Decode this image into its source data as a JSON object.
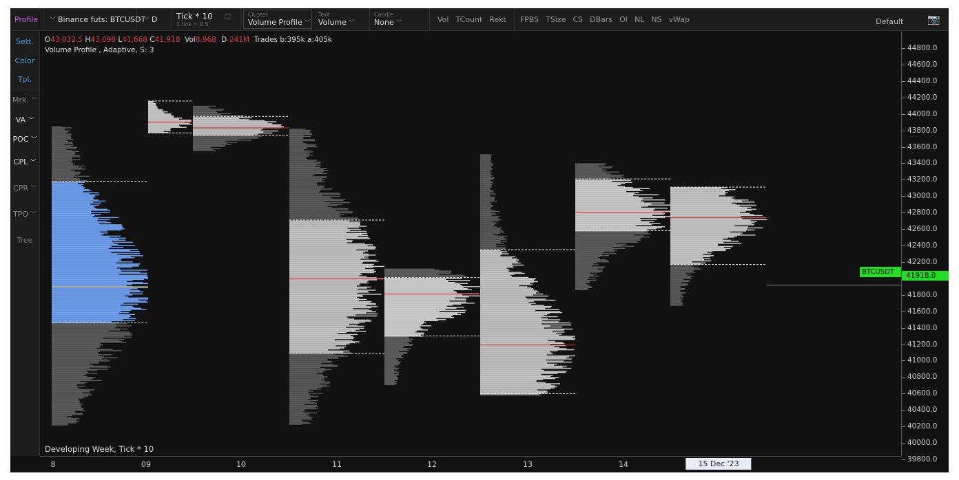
{
  "toolbar": {
    "profile": "Profile",
    "instrument": "Binance futs: BTCUSDT",
    "timeframe": "D",
    "tick": "Tick * 10",
    "tick_sub": "1 tick = 0.5",
    "cluster_cap": "Cluster",
    "cluster": "Volume Profile",
    "text_cap": "Text",
    "text": "Volume",
    "candle_cap": "Candle",
    "candle": "None",
    "toggles1": [
      "Vol",
      "TCount",
      "Rekt"
    ],
    "toggles2": [
      "FPBS",
      "TSize",
      "CS",
      "DBars",
      "OI",
      "NL",
      "NS",
      "vWap"
    ],
    "template": "Default",
    "camera_icon": "camera-icon"
  },
  "sidebar": {
    "top": [
      "Sett.",
      "Color",
      "Tpl."
    ],
    "items": [
      "Mrk.",
      "VA",
      "POC",
      "CPL",
      "CPR",
      "TPO",
      "Tree"
    ]
  },
  "info": {
    "o_label": "O",
    "o": "43,032.5",
    "h_label": "H",
    "h": "43,098",
    "l_label": "L",
    "l": "41,668",
    "c_label": "C",
    "c": "41,918",
    "vol_label": "Vol",
    "vol": "8.96B",
    "d_label": "D",
    "d": "-241M",
    "trades": "Trades b:395k a:405k",
    "subtitle": "Volume Profile , Adaptive, S: 3"
  },
  "footer": "Developing Week, Tick * 10",
  "price": {
    "symbol": "BTCUSDT",
    "last": "41918.0",
    "last_value": 41918
  },
  "axis_ticks": [
    "44800.0",
    "44600.0",
    "44400.0",
    "44200.0",
    "44000.0",
    "43800.0",
    "43600.0",
    "43400.0",
    "43200.0",
    "43000.0",
    "42800.0",
    "42600.0",
    "42400.0",
    "42200.0",
    "42000.0",
    "41800.0",
    "41600.0",
    "41400.0",
    "41200.0",
    "41000.0",
    "40800.0",
    "40600.0",
    "40400.0",
    "40200.0",
    "40000.0",
    "39800.0"
  ],
  "dates": [
    "8",
    "09",
    "10",
    "11",
    "12",
    "13",
    "14",
    "15 Dec '23"
  ],
  "colors": {
    "accent_profile": "#c060e0",
    "sett": "#4a9ad8",
    "va_current": "#6ea0f0",
    "va": "#c8c8c8",
    "outside": "#5a5a5a",
    "poc": "#e02020",
    "price": "#22dd22"
  },
  "profiles": [
    {
      "date": "8",
      "high": 43850,
      "low": 40225,
      "vah": 43180,
      "val": 41460,
      "poc": 41900,
      "highlight": true
    },
    {
      "date": "09",
      "high": 44157,
      "low": 43770,
      "vah": 44157,
      "val": 43770,
      "poc": 43900
    },
    {
      "date": "10",
      "high": 44100,
      "low": 43550,
      "vah": 43970,
      "val": 43740,
      "poc": 43830
    },
    {
      "date": "11",
      "high": 43820,
      "low": 40230,
      "vah": 42710,
      "val": 41090,
      "poc": 42000
    },
    {
      "date": "12",
      "high": 42120,
      "low": 40710,
      "vah": 42010,
      "val": 41300,
      "poc": 41810
    },
    {
      "date": "13",
      "high": 43510,
      "low": 40580,
      "vah": 42350,
      "val": 40600,
      "poc": 41190
    },
    {
      "date": "14",
      "high": 43400,
      "low": 41860,
      "vah": 43210,
      "val": 42580,
      "poc": 42800
    },
    {
      "date": "15 Dec '23",
      "high": 43110,
      "low": 41670,
      "vah": 43110,
      "val": 42170,
      "poc": 42740
    }
  ]
}
